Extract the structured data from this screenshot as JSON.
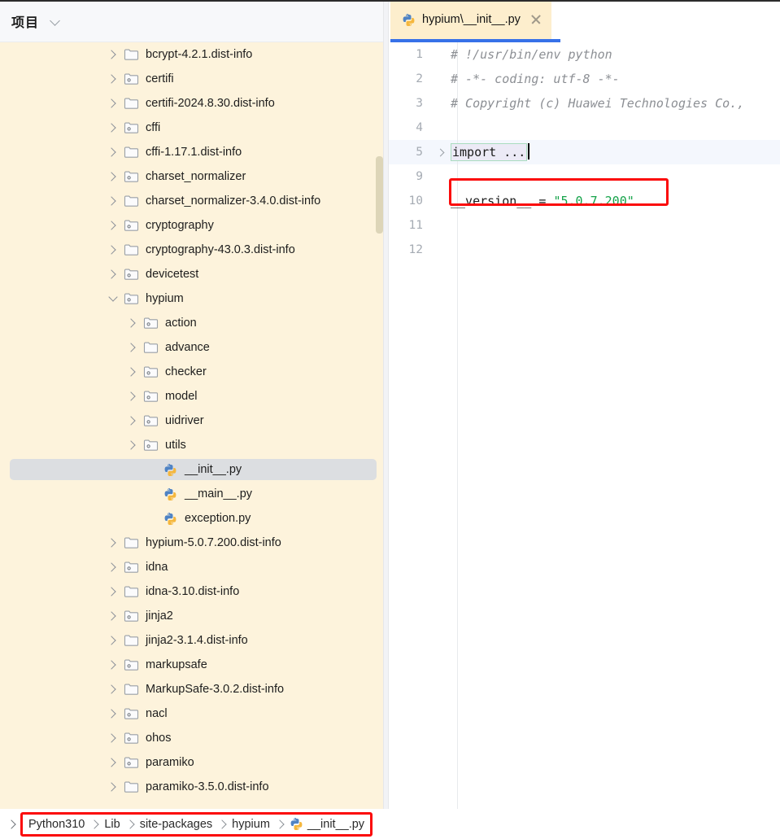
{
  "colors": {
    "panel_bg": "#fdf3dc",
    "header_bg": "#f7f8fa",
    "tab_bg": "#fdeecd",
    "tab_underline": "#3771e8",
    "selection": "#dcdee1",
    "annotation_red": "#fb0a0a",
    "string_green": "#16a34a",
    "comment_gray": "#8c8f94",
    "scrollbar": "#ddd5b8"
  },
  "project_panel": {
    "title": "项目",
    "dropdown_icon": "chevron-down-icon",
    "tree": [
      {
        "label": "bcrypt-4.2.1.dist-info",
        "indent": 0,
        "icon": "folder-icon",
        "arrow": "collapsed",
        "selected": false
      },
      {
        "label": "certifi",
        "indent": 0,
        "icon": "package-folder-icon",
        "arrow": "collapsed",
        "selected": false
      },
      {
        "label": "certifi-2024.8.30.dist-info",
        "indent": 0,
        "icon": "folder-icon",
        "arrow": "collapsed",
        "selected": false
      },
      {
        "label": "cffi",
        "indent": 0,
        "icon": "package-folder-icon",
        "arrow": "collapsed",
        "selected": false
      },
      {
        "label": "cffi-1.17.1.dist-info",
        "indent": 0,
        "icon": "folder-icon",
        "arrow": "collapsed",
        "selected": false
      },
      {
        "label": "charset_normalizer",
        "indent": 0,
        "icon": "package-folder-icon",
        "arrow": "collapsed",
        "selected": false
      },
      {
        "label": "charset_normalizer-3.4.0.dist-info",
        "indent": 0,
        "icon": "folder-icon",
        "arrow": "collapsed",
        "selected": false
      },
      {
        "label": "cryptography",
        "indent": 0,
        "icon": "package-folder-icon",
        "arrow": "collapsed",
        "selected": false
      },
      {
        "label": "cryptography-43.0.3.dist-info",
        "indent": 0,
        "icon": "folder-icon",
        "arrow": "collapsed",
        "selected": false
      },
      {
        "label": "devicetest",
        "indent": 0,
        "icon": "package-folder-icon",
        "arrow": "collapsed",
        "selected": false
      },
      {
        "label": "hypium",
        "indent": 0,
        "icon": "package-folder-icon",
        "arrow": "expanded",
        "selected": false
      },
      {
        "label": "action",
        "indent": 1,
        "icon": "package-folder-icon",
        "arrow": "collapsed",
        "selected": false
      },
      {
        "label": "advance",
        "indent": 1,
        "icon": "folder-icon",
        "arrow": "collapsed",
        "selected": false
      },
      {
        "label": "checker",
        "indent": 1,
        "icon": "package-folder-icon",
        "arrow": "collapsed",
        "selected": false
      },
      {
        "label": "model",
        "indent": 1,
        "icon": "package-folder-icon",
        "arrow": "collapsed",
        "selected": false
      },
      {
        "label": "uidriver",
        "indent": 1,
        "icon": "package-folder-icon",
        "arrow": "collapsed",
        "selected": false
      },
      {
        "label": "utils",
        "indent": 1,
        "icon": "package-folder-icon",
        "arrow": "collapsed",
        "selected": false
      },
      {
        "label": "__init__.py",
        "indent": 2,
        "icon": "python-file-icon",
        "arrow": "none",
        "selected": true
      },
      {
        "label": "__main__.py",
        "indent": 2,
        "icon": "python-file-icon",
        "arrow": "none",
        "selected": false
      },
      {
        "label": "exception.py",
        "indent": 2,
        "icon": "python-file-icon",
        "arrow": "none",
        "selected": false
      },
      {
        "label": "hypium-5.0.7.200.dist-info",
        "indent": 0,
        "icon": "folder-icon",
        "arrow": "collapsed",
        "selected": false
      },
      {
        "label": "idna",
        "indent": 0,
        "icon": "package-folder-icon",
        "arrow": "collapsed",
        "selected": false
      },
      {
        "label": "idna-3.10.dist-info",
        "indent": 0,
        "icon": "folder-icon",
        "arrow": "collapsed",
        "selected": false
      },
      {
        "label": "jinja2",
        "indent": 0,
        "icon": "package-folder-icon",
        "arrow": "collapsed",
        "selected": false
      },
      {
        "label": "jinja2-3.1.4.dist-info",
        "indent": 0,
        "icon": "folder-icon",
        "arrow": "collapsed",
        "selected": false
      },
      {
        "label": "markupsafe",
        "indent": 0,
        "icon": "package-folder-icon",
        "arrow": "collapsed",
        "selected": false
      },
      {
        "label": "MarkupSafe-3.0.2.dist-info",
        "indent": 0,
        "icon": "folder-icon",
        "arrow": "collapsed",
        "selected": false
      },
      {
        "label": "nacl",
        "indent": 0,
        "icon": "package-folder-icon",
        "arrow": "collapsed",
        "selected": false
      },
      {
        "label": "ohos",
        "indent": 0,
        "icon": "package-folder-icon",
        "arrow": "collapsed",
        "selected": false
      },
      {
        "label": "paramiko",
        "indent": 0,
        "icon": "package-folder-icon",
        "arrow": "collapsed",
        "selected": false
      },
      {
        "label": "paramiko-3.5.0.dist-info",
        "indent": 0,
        "icon": "folder-icon",
        "arrow": "collapsed",
        "selected": false
      }
    ]
  },
  "editor": {
    "tab": {
      "label": "hypium\\__init__.py",
      "icon": "python-file-icon",
      "close_icon": "close-icon",
      "active": true
    },
    "lines": [
      {
        "no": "1",
        "type": "comment",
        "text": "# !/usr/bin/env python",
        "active": false,
        "fold": false
      },
      {
        "no": "2",
        "type": "comment",
        "text": "# -*- coding: utf-8 -*-",
        "active": false,
        "fold": false
      },
      {
        "no": "3",
        "type": "comment",
        "text": "# Copyright (c) Huawei Technologies Co.,",
        "active": false,
        "fold": false
      },
      {
        "no": "4",
        "type": "blank",
        "text": "",
        "active": false,
        "fold": false
      },
      {
        "no": "5",
        "type": "folded",
        "text": "import ...",
        "active": true,
        "fold": true
      },
      {
        "no": "9",
        "type": "blank",
        "text": "",
        "active": false,
        "fold": false
      },
      {
        "no": "10",
        "type": "code",
        "text": "__version__ = \"5.0.7.200\"",
        "active": false,
        "fold": false,
        "tokens": [
          {
            "t": "__version__ ",
            "c": "plain"
          },
          {
            "t": "= ",
            "c": "op"
          },
          {
            "t": "\"5.0.7.200\"",
            "c": "str"
          }
        ]
      },
      {
        "no": "11",
        "type": "blank",
        "text": "",
        "active": false,
        "fold": false
      },
      {
        "no": "12",
        "type": "blank",
        "text": "",
        "active": false,
        "fold": false
      }
    ]
  },
  "breadcrumb": {
    "lead_icon": "chevron-right-icon",
    "items": [
      {
        "label": "Python310",
        "icon": null
      },
      {
        "label": "Lib",
        "icon": null
      },
      {
        "label": "site-packages",
        "icon": null
      },
      {
        "label": "hypium",
        "icon": null
      },
      {
        "label": "__init__.py",
        "icon": "python-file-icon"
      }
    ]
  }
}
